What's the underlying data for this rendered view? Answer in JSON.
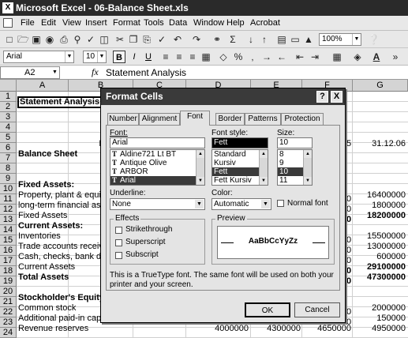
{
  "window": {
    "title": "Microsoft Excel - 06-Balance Sheet.xls"
  },
  "menu": [
    "File",
    "Edit",
    "View",
    "Insert",
    "Format",
    "Tools",
    "Data",
    "Window",
    "Help",
    "Acrobat"
  ],
  "toolbar": {
    "zoom": "100%"
  },
  "format_bar": {
    "font": "Arial",
    "size": "10",
    "bold": "B",
    "italic": "I",
    "underline": "U"
  },
  "formula_bar": {
    "name_box": "A2",
    "fx": "fx",
    "value": "Statement Analysis"
  },
  "columns": [
    "A",
    "B",
    "C",
    "D",
    "E",
    "F",
    "G"
  ],
  "rows": [
    "1",
    "2",
    "3",
    "4",
    "5",
    "6",
    "7",
    "8",
    "9",
    "10",
    "11",
    "12",
    "13",
    "14",
    "15",
    "16",
    "17",
    "18",
    "19",
    "20",
    "21",
    "22",
    "23",
    "24"
  ],
  "cells": {
    "r2_a": "Statement Analysis",
    "r6_c": "Financia",
    "r6_f": "5",
    "r6_g": "31.12.06",
    "r7_a": "Balance Sheet",
    "r10_a": "Fixed Assets:",
    "r11_a": "Property, plant & equip",
    "r11_g": "16400000",
    "r12_a": "long-term financial ass",
    "r12_g": "1800000",
    "r13_a": "Fixed Assets",
    "r13_g": "18200000",
    "r14_a": "Current Assets:",
    "r15_a": "Inventories",
    "r15_g": "15500000",
    "r16_a": "Trade accounts receiva",
    "r16_g": "13000000",
    "r17_a": "Cash, checks, bank de",
    "r17_g": "600000",
    "r18_a": "Current Assets",
    "r18_g": "29100000",
    "r19_a": "Total Assets",
    "r19_g": "47300000",
    "r21_a": "Stockholder's Equity:",
    "r22_a": "Common stock",
    "r22_g": "2000000",
    "r23_a": "Additional paid-in capit",
    "r23_g": "150000",
    "r24_a": "Revenue reserves",
    "r24_d": "4000000",
    "r24_e": "4300000",
    "r24_f": "4650000",
    "r24_g": "4950000",
    "e_digits": [
      "0",
      "0",
      "0",
      "0",
      "0",
      "0",
      "0",
      "0",
      "0",
      "0",
      "0",
      "0"
    ]
  },
  "dialog": {
    "title": "Format Cells",
    "help": "?",
    "close": "X",
    "tabs": [
      "Number",
      "Alignment",
      "Font",
      "Border",
      "Patterns",
      "Protection"
    ],
    "font_label": "Font:",
    "font_value": "Arial",
    "font_list": [
      "Aldine721 Lt BT",
      "Antique Olive",
      "ARBOR",
      "Arial"
    ],
    "style_label": "Font style:",
    "style_value": "Fett",
    "style_list": [
      "Standard",
      "Kursiv",
      "Fett",
      "Fett Kursiv"
    ],
    "size_label": "Size:",
    "size_value": "10",
    "size_list": [
      "8",
      "9",
      "10",
      "11"
    ],
    "underline_label": "Underline:",
    "underline_value": "None",
    "color_label": "Color:",
    "color_value": "Automatic",
    "normal_font": "Normal font",
    "effects_label": "Effects",
    "strikethrough": "Strikethrough",
    "superscript": "Superscript",
    "subscript": "Subscript",
    "preview_label": "Preview",
    "preview_text": "AaBbCcYyZz",
    "info": "This is a TrueType font.  The same font will be used on both your printer and your screen.",
    "ok": "OK",
    "cancel": "Cancel"
  }
}
